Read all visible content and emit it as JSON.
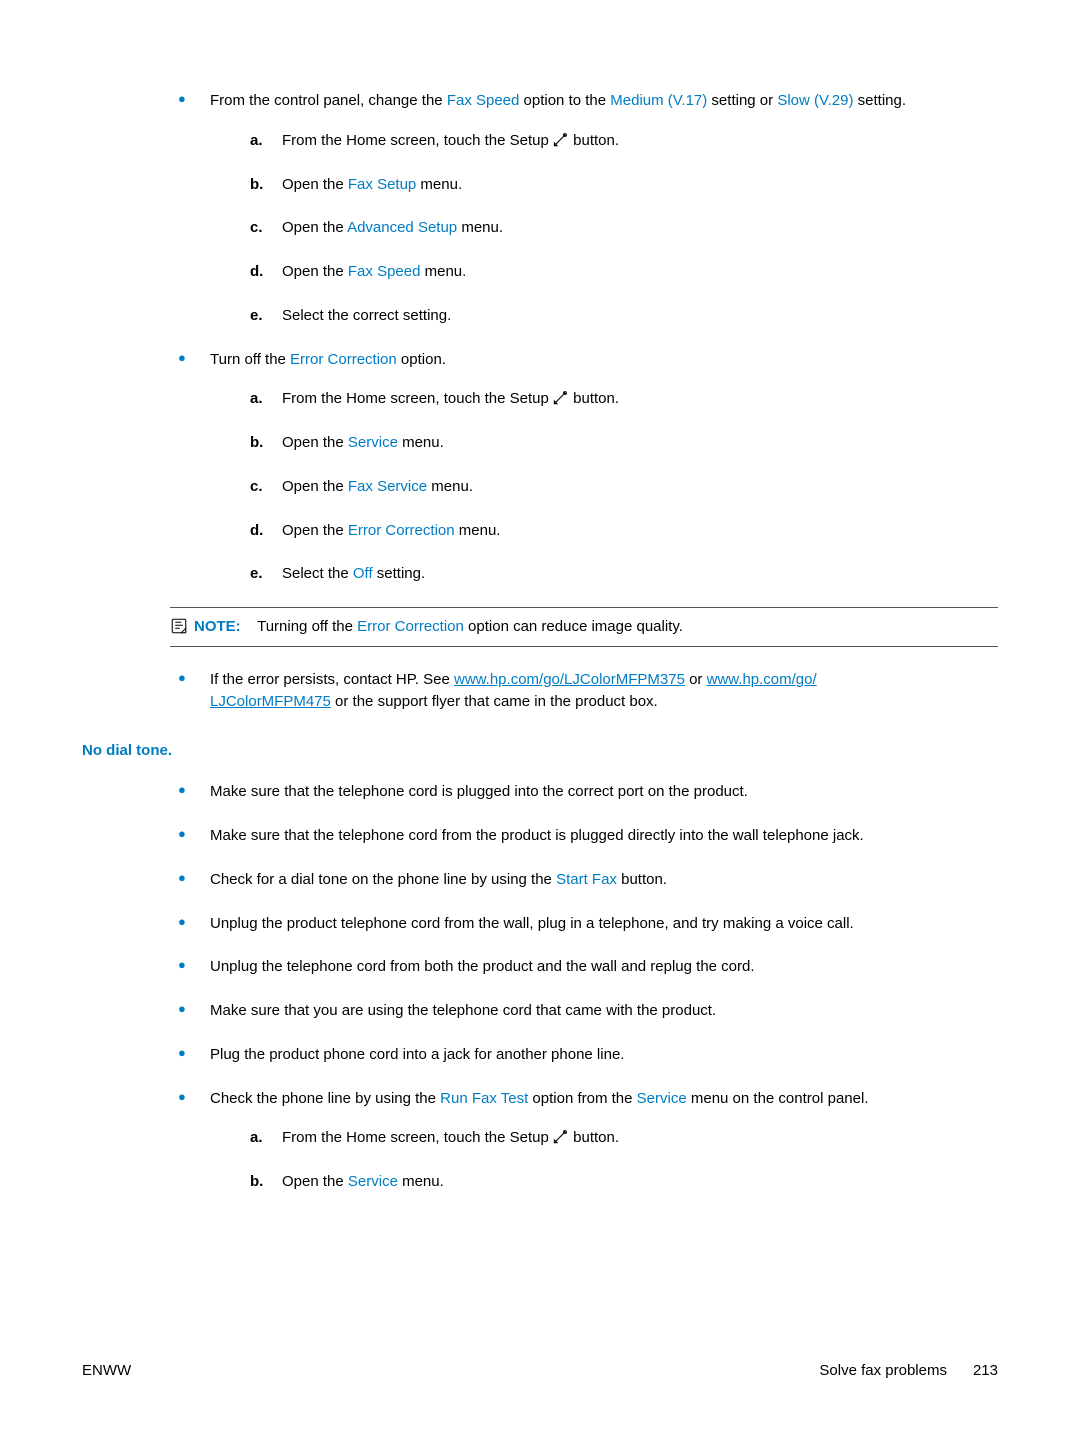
{
  "section1": {
    "intro": {
      "pre": "From the control panel, change the ",
      "opt1": "Fax Speed",
      "mid1": " option to the ",
      "opt2": "Medium (V.17)",
      "mid2": " setting or ",
      "opt3": "Slow (V.29)",
      "post": " setting."
    },
    "steps": {
      "a": {
        "m": "a.",
        "pre": "From the Home screen, touch the Setup ",
        "post": " button."
      },
      "b": {
        "m": "b.",
        "pre": "Open the ",
        "opt": "Fax Setup",
        "post": " menu."
      },
      "c": {
        "m": "c.",
        "pre": "Open the ",
        "opt": "Advanced Setup",
        "post": " menu."
      },
      "d": {
        "m": "d.",
        "pre": "Open the ",
        "opt": "Fax Speed",
        "post": " menu."
      },
      "e": {
        "m": "e.",
        "text": "Select the correct setting."
      }
    }
  },
  "section2": {
    "intro": {
      "pre": "Turn off the ",
      "opt": "Error Correction",
      "post": " option."
    },
    "steps": {
      "a": {
        "m": "a.",
        "pre": "From the Home screen, touch the Setup ",
        "post": " button."
      },
      "b": {
        "m": "b.",
        "pre": "Open the ",
        "opt": "Service",
        "post": " menu."
      },
      "c": {
        "m": "c.",
        "pre": "Open the ",
        "opt": "Fax Service",
        "post": " menu."
      },
      "d": {
        "m": "d.",
        "pre": "Open the ",
        "opt": "Error Correction",
        "post": " menu."
      },
      "e": {
        "m": "e.",
        "pre": "Select the ",
        "opt": "Off",
        "post": " setting."
      }
    }
  },
  "note": {
    "label": "NOTE:",
    "pre": "Turning off the ",
    "opt": "Error Correction",
    "post": " option can reduce image quality."
  },
  "section3": {
    "pre": "If the error persists, contact HP. See ",
    "link1": "www.hp.com/go/LJColorMFPM375",
    "mid": " or ",
    "link2a": "www.hp.com/go/",
    "link2b": "LJColorMFPM475",
    "post": " or the support flyer that came in the product box."
  },
  "heading": "No dial tone.",
  "dial": {
    "b1": "Make sure that the telephone cord is plugged into the correct port on the product.",
    "b2": "Make sure that the telephone cord from the product is plugged directly into the wall telephone jack.",
    "b3": {
      "pre": "Check for a dial tone on the phone line by using the ",
      "opt": "Start Fax",
      "post": " button."
    },
    "b4": "Unplug the product telephone cord from the wall, plug in a telephone, and try making a voice call.",
    "b5": "Unplug the telephone cord from both the product and the wall and replug the cord.",
    "b6": "Make sure that you are using the telephone cord that came with the product.",
    "b7": "Plug the product phone cord into a jack for another phone line.",
    "b8": {
      "pre": "Check the phone line by using the ",
      "opt1": "Run Fax Test",
      "mid": " option from the ",
      "opt2": "Service",
      "post": " menu on the control panel."
    },
    "steps": {
      "a": {
        "m": "a.",
        "pre": "From the Home screen, touch the Setup ",
        "post": " button."
      },
      "b": {
        "m": "b.",
        "pre": "Open the ",
        "opt": "Service",
        "post": " menu."
      }
    }
  },
  "footer": {
    "left": "ENWW",
    "right_text": "Solve fax problems",
    "page": "213"
  }
}
